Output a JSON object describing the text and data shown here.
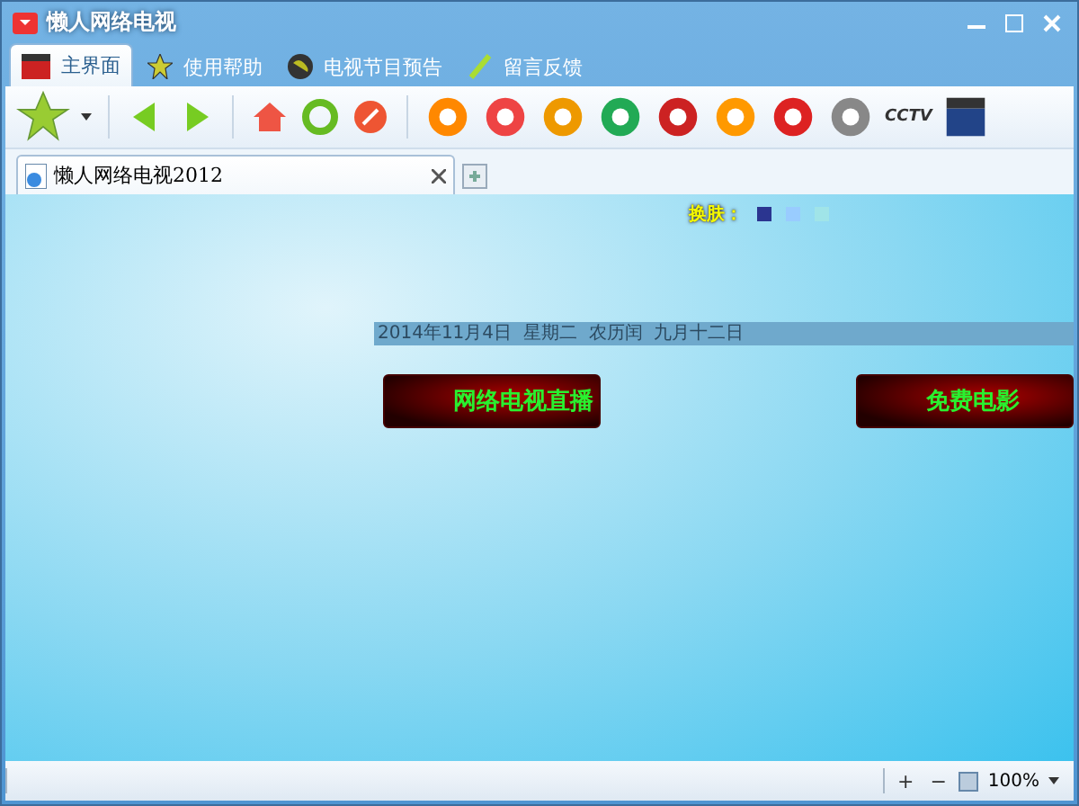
{
  "window": {
    "title": "懒人网络电视"
  },
  "menu_tabs": [
    {
      "label": "主界面",
      "selected": true,
      "kind": "clapper"
    },
    {
      "label": "使用帮助",
      "selected": false,
      "kind": "star"
    },
    {
      "label": "电视节目预告",
      "selected": false,
      "kind": "globe"
    },
    {
      "label": "留言反馈",
      "selected": false,
      "kind": "pen"
    }
  ],
  "toolbar": {
    "logo_text": "CCTV"
  },
  "browser_tab": {
    "title": "懒人网络电视2012"
  },
  "content": {
    "skin_label": "换肤：",
    "skins": [
      {
        "color": "#2b3590",
        "selected": false
      },
      {
        "color": "#99ccff",
        "selected": false
      },
      {
        "color": "#a0e4e8",
        "selected": false
      }
    ],
    "date_line": "2014年11月4日  星期二  农历闰  九月十二日",
    "buttons": [
      "网络电视直播",
      "免费电影"
    ]
  },
  "status_bar": {
    "zoom": "100%",
    "zoom_in": "+",
    "zoom_out": "−"
  }
}
